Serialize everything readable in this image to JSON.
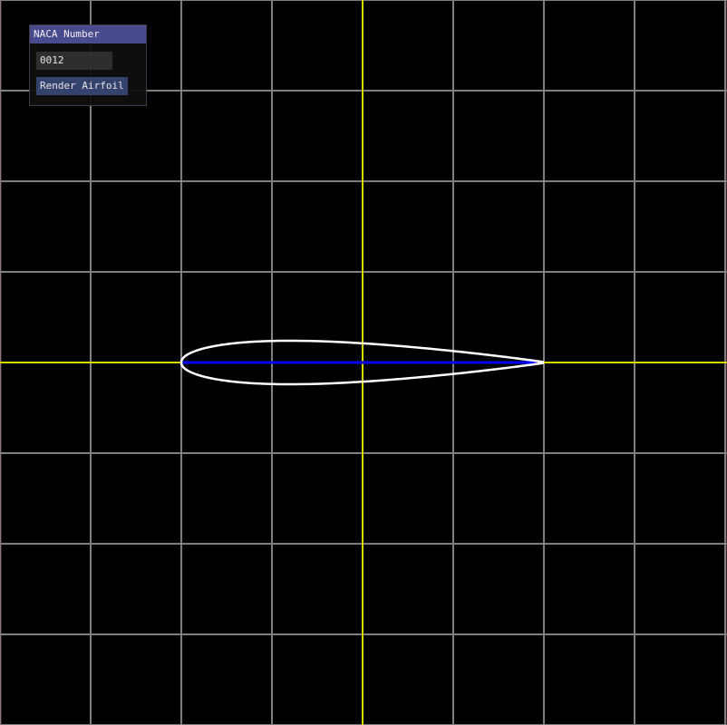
{
  "panel": {
    "title": "NACA Number",
    "naca_value": "0012",
    "render_label": "Render Airfoil"
  },
  "plot": {
    "grid_color": "#808080",
    "axis_color": "#d8d800",
    "airfoil_color": "#ffffff",
    "camber_color": "#0000ff",
    "background": "#000000"
  },
  "airfoil": {
    "naca": "0012",
    "chord": 1.0,
    "max_thickness": 0.12,
    "leading_edge_x": -0.5,
    "trailing_edge_x": 0.5
  }
}
